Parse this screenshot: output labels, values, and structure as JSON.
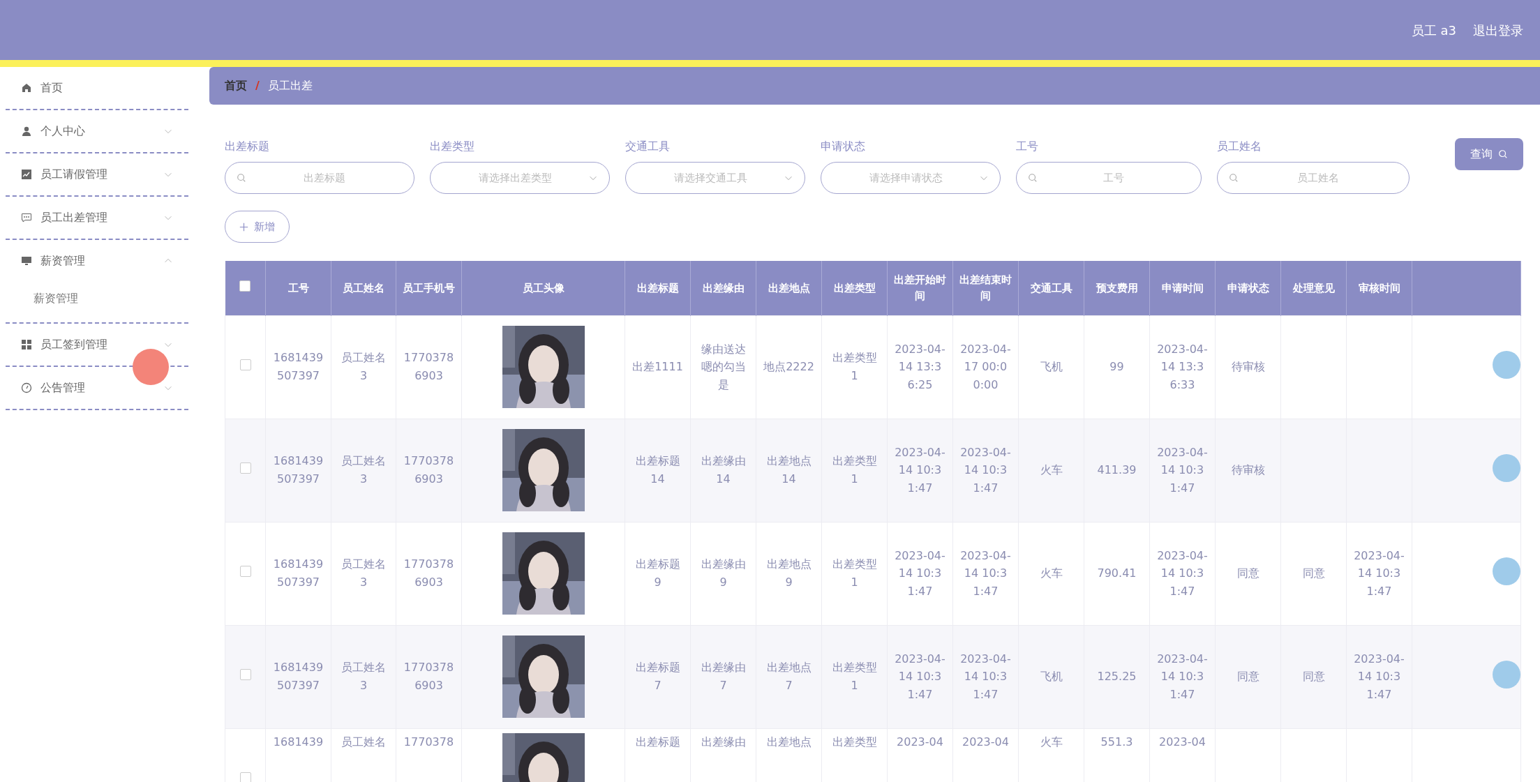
{
  "header": {
    "user": "员工 a3",
    "logout": "退出登录"
  },
  "sidebar": {
    "items": [
      {
        "label": "首页",
        "kind": "link"
      },
      {
        "label": "个人中心",
        "kind": "menu",
        "expanded": false
      },
      {
        "label": "员工请假管理",
        "kind": "menu",
        "expanded": false
      },
      {
        "label": "员工出差管理",
        "kind": "menu",
        "expanded": false
      },
      {
        "label": "薪资管理",
        "kind": "menu",
        "expanded": true,
        "children": [
          {
            "label": "薪资管理"
          }
        ]
      },
      {
        "label": "员工签到管理",
        "kind": "menu",
        "expanded": false
      },
      {
        "label": "公告管理",
        "kind": "menu",
        "expanded": false
      }
    ]
  },
  "breadcrumb": [
    "首页",
    "员工出差"
  ],
  "breadcrumb_separator": "/",
  "filters": [
    {
      "label": "出差标题",
      "kind": "search",
      "placeholder": "出差标题"
    },
    {
      "label": "出差类型",
      "kind": "select",
      "placeholder": "请选择出差类型"
    },
    {
      "label": "交通工具",
      "kind": "select",
      "placeholder": "请选择交通工具"
    },
    {
      "label": "申请状态",
      "kind": "select",
      "placeholder": "请选择申请状态"
    },
    {
      "label": "工号",
      "kind": "search",
      "placeholder": "工号"
    },
    {
      "label": "员工姓名",
      "kind": "search",
      "placeholder": "员工姓名"
    }
  ],
  "search_button": "查询",
  "add_button": "新增",
  "table": {
    "select_all_checked": false,
    "columns": [
      "工号",
      "员工姓名",
      "员工手机号",
      "员工头像",
      "出差标题",
      "出差缘由",
      "出差地点",
      "出差类型",
      "出差开始时间",
      "出差结束时间",
      "交通工具",
      "预支费用",
      "申请时间",
      "申请状态",
      "处理意见",
      "审核时间"
    ],
    "rows": [
      {
        "checked": false,
        "cells": [
          "1681439507397",
          "员工姓名3",
          "17703786903",
          {
            "kind": "picture"
          },
          "出差1111",
          "缘由送达嗯的勾当是",
          "地点2222",
          "出差类型1",
          "2023-04-14 13:36:25",
          "2023-04-17 00:00:00",
          "飞机",
          "99",
          "2023-04-14 13:36:33",
          "待审核",
          "",
          ""
        ]
      },
      {
        "checked": false,
        "cells": [
          "1681439507397",
          "员工姓名3",
          "17703786903",
          {
            "kind": "picture"
          },
          "出差标题14",
          "出差缘由14",
          "出差地点14",
          "出差类型1",
          "2023-04-14 10:31:47",
          "2023-04-14 10:31:47",
          "火车",
          "411.39",
          "2023-04-14 10:31:47",
          "待审核",
          "",
          ""
        ]
      },
      {
        "checked": false,
        "cells": [
          "1681439507397",
          "员工姓名3",
          "17703786903",
          {
            "kind": "picture"
          },
          "出差标题9",
          "出差缘由9",
          "出差地点9",
          "出差类型1",
          "2023-04-14 10:31:47",
          "2023-04-14 10:31:47",
          "火车",
          "790.41",
          "2023-04-14 10:31:47",
          "同意",
          "同意",
          "2023-04-14 10:31:47"
        ]
      },
      {
        "checked": false,
        "cells": [
          "1681439507397",
          "员工姓名3",
          "17703786903",
          {
            "kind": "picture"
          },
          "出差标题7",
          "出差缘由7",
          "出差地点7",
          "出差类型1",
          "2023-04-14 10:31:47",
          "2023-04-14 10:31:47",
          "飞机",
          "125.25",
          "2023-04-14 10:31:47",
          "同意",
          "同意",
          "2023-04-14 10:31:47"
        ]
      },
      {
        "checked": false,
        "cells": [
          "1681439",
          "员工姓名",
          "1770378",
          {
            "kind": "picture"
          },
          "出差标题",
          "出差缘由",
          "出差地点",
          "出差类型",
          "2023-04",
          "2023-04",
          "火车",
          "551.3",
          "2023-04",
          "",
          "",
          ""
        ]
      }
    ]
  }
}
